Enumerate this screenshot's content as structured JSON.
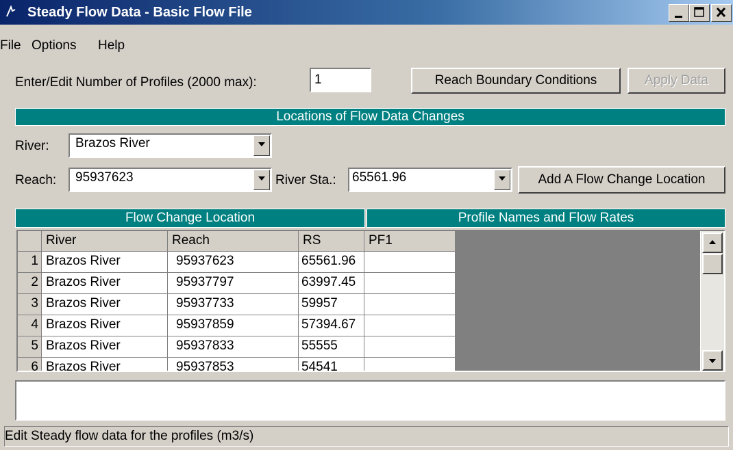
{
  "window": {
    "title": "Steady Flow Data - Basic Flow File"
  },
  "menu": {
    "file": "File",
    "options": "Options",
    "help": "Help"
  },
  "profiles": {
    "label": "Enter/Edit Number of Profiles (2000 max):",
    "value": "1"
  },
  "buttons": {
    "reach_bc": "Reach Boundary Conditions",
    "apply": "Apply Data",
    "add_location": "Add A Flow Change Location"
  },
  "locations_header": "Locations of Flow Data Changes",
  "selectors": {
    "river_label": "River:",
    "river_value": "Brazos River",
    "reach_label": "Reach:",
    "reach_value": "95937623",
    "sta_label": "River Sta.:",
    "sta_value": "65561.96"
  },
  "table": {
    "group_left": "Flow Change Location",
    "group_right": "Profile Names and Flow Rates",
    "columns": [
      "River",
      "Reach",
      "RS",
      "PF1"
    ],
    "rows": [
      {
        "n": "1",
        "river": "Brazos River",
        "reach": "95937623",
        "rs": "65561.96",
        "pf1": ""
      },
      {
        "n": "2",
        "river": "Brazos River",
        "reach": "95937797",
        "rs": "63997.45",
        "pf1": ""
      },
      {
        "n": "3",
        "river": "Brazos River",
        "reach": "95937733",
        "rs": "59957",
        "pf1": ""
      },
      {
        "n": "4",
        "river": "Brazos River",
        "reach": "95937859",
        "rs": "57394.67",
        "pf1": ""
      },
      {
        "n": "5",
        "river": "Brazos River",
        "reach": "95937833",
        "rs": "55555",
        "pf1": ""
      },
      {
        "n": "6",
        "river": "Brazos River",
        "reach": "95937853",
        "rs": "54541",
        "pf1": ""
      }
    ]
  },
  "status": "Edit Steady flow data for the profiles (m3/s)",
  "colors": {
    "title_start": "#0a246a",
    "header_teal": "#008080",
    "face": "#d4d0c8"
  }
}
